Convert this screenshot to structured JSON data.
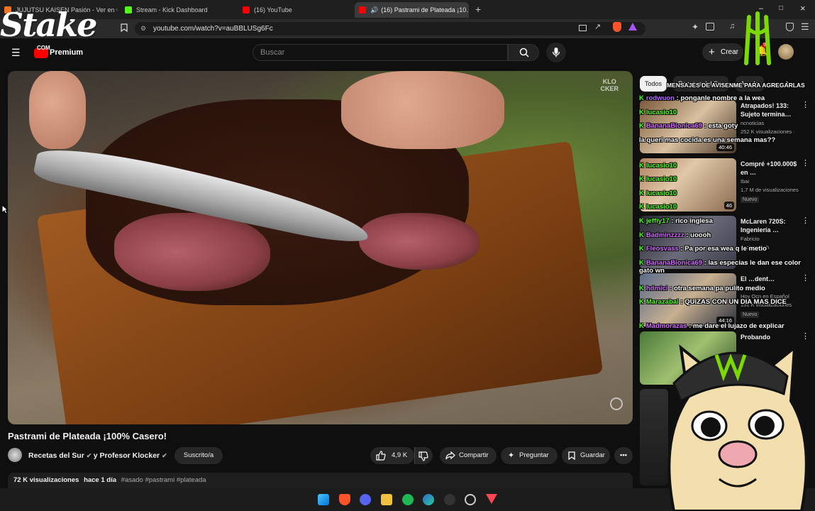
{
  "browser": {
    "tabs": [
      {
        "label": "JUJUTSU KAISEN Pasión - Ver en Crunchyroll",
        "color": "#f47521"
      },
      {
        "label": "Stream - Kick Dashboard",
        "color": "#53fc18"
      },
      {
        "label": "(16) YouTube",
        "color": "#ff0000"
      },
      {
        "label": "(16) Pastrami de Plateada ¡10…",
        "color": "#ff0000"
      }
    ],
    "new_tab": "+",
    "close_tab": "×",
    "url": "youtube.com/watch?v=auBBLUSg6Fc",
    "window_controls": [
      "–",
      "□",
      "×"
    ]
  },
  "youtube": {
    "logo_label": "Premium",
    "search_placeholder": "Buscar",
    "create_label": "Crear",
    "notification_count": "9+"
  },
  "video": {
    "title": "Pastrami de Plateada ¡100% Casero!",
    "watermark": "KLO\nCKER",
    "channel": "Recetas del Sur",
    "collab": "y Profesor Klocker",
    "subscribe_label": "Suscrito/a",
    "likes": "4,9 K",
    "share_label": "Compartir",
    "ask_label": "Preguntar",
    "save_label": "Guardar",
    "views": "72 K visualizaciones",
    "date": "hace 1 día",
    "tags": "#asado #pastrami #plateada"
  },
  "sidebar": {
    "chips": [
      "Todos",
      "Recetas del Sur",
      "Asado"
    ],
    "recommendations": [
      {
        "title": "Atrapados! 133: Sujeto termina…",
        "channel": "ncnoticias",
        "views": "252 K visualizaciones ·",
        "badge": "",
        "duration": "40:46",
        "thumb": "#7a5a3a"
      },
      {
        "title": "Compré +100.000$ en …",
        "channel": "Ibai",
        "views": "1,7 M de visualizaciones",
        "badge": "Nuevo",
        "duration": "46",
        "thumb": "#8a6a50"
      },
      {
        "title": "McLaren 720S: Ingeniería …",
        "channel": "Fabricio",
        "views": "zaciones · h",
        "badge": "",
        "duration": "",
        "thumb": "#3a3a48"
      },
      {
        "title": "El …dent…",
        "channel": "Hoy Ocn en Español",
        "views": "131 K visualizaciones",
        "badge": "Nuevo",
        "duration": "44:16",
        "thumb": "#5a6a8a"
      },
      {
        "title": "Probando",
        "channel": "",
        "views": "",
        "badge": "",
        "duration": "",
        "thumb": "#4a7a3a"
      }
    ]
  },
  "chat": [
    {
      "text": "MENSAJES DE AVISENME PARA AGREGARLAS",
      "user": "",
      "color": "#ffffff"
    },
    {
      "user": "rodwuon",
      "text": "ponganle nombre a la wea",
      "color": "#b36bff"
    },
    {
      "user": "lucasio10",
      "text": "",
      "color": "#53fc18"
    },
    {
      "user": "BananaBionica69",
      "text": "esta goty",
      "color": "#d46bff"
    },
    {
      "user": "",
      "text": "la queri mas cocida es una semana mas??",
      "color": "#ffffff"
    },
    {
      "user": "lucasio10",
      "text": "",
      "color": "#53fc18"
    },
    {
      "user": "lucasio10",
      "text": "",
      "color": "#53fc18"
    },
    {
      "user": "lucasio10",
      "text": "",
      "color": "#53fc18"
    },
    {
      "user": "lucasio10",
      "text": "",
      "color": "#53fc18"
    },
    {
      "user": "jeffiy17",
      "text": "rico inglesa",
      "color": "#53fc18"
    },
    {
      "user": "Badminzzzz",
      "text": "uoooh",
      "color": "#d46bff"
    },
    {
      "user": "Fleosvass",
      "text": "Pa por esa wea q le metio",
      "color": "#d46bff"
    },
    {
      "user": "BananaBionica69",
      "text": "las especias le dan ese color gato wn",
      "color": "#d46bff"
    },
    {
      "user": "hdmici",
      "text": "otra semana pa pulito medio",
      "color": "#d46bff"
    },
    {
      "user": "Marazabal",
      "text": "QUIZAS CON UN DIA MAS DICE",
      "color": "#53fc18"
    },
    {
      "user": "Madmorazas",
      "text": "me dare el lujazo de explicar",
      "color": "#d46bff"
    }
  ],
  "overlay": {
    "stake_brand": "Stake",
    "stake_suffix": "COM"
  },
  "colors": {
    "yt_red": "#ff0000",
    "kick_green": "#53fc18",
    "monster_green": "#7cd900"
  }
}
